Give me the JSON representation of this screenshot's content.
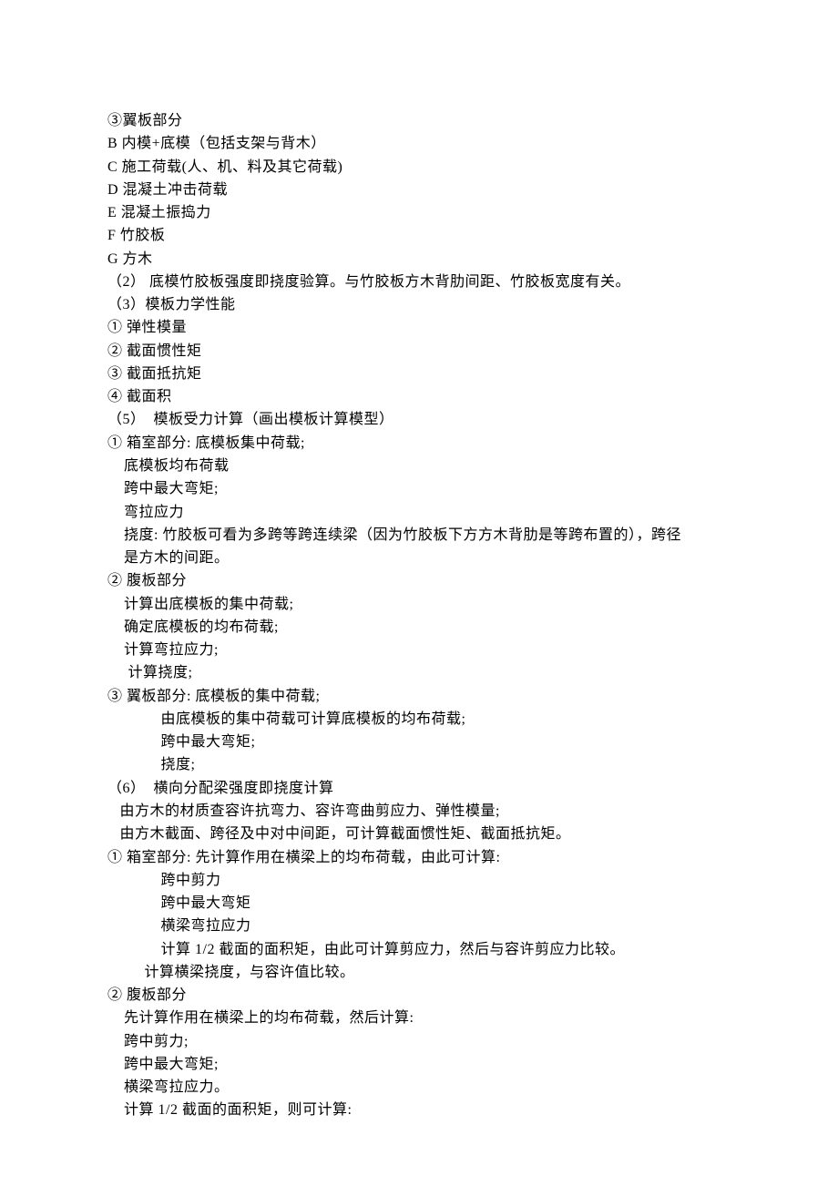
{
  "lines": [
    "③翼板部分",
    "B 内模+底模（包括支架与背木）",
    "C 施工荷载(人、机、料及其它荷载)",
    "D 混凝土冲击荷载",
    "E 混凝土振捣力",
    "F 竹胶板",
    "G 方木",
    "（2） 底模竹胶板强度即挠度验算。与竹胶板方木背肋间距、竹胶板宽度有关。",
    "（3）模板力学性能",
    "① 弹性模量",
    "② 截面惯性矩",
    "③ 截面抵抗矩",
    "④ 截面积",
    "（5）  模板受力计算（画出模板计算模型）",
    "① 箱室部分: 底模板集中荷载;",
    "    底模板均布荷载",
    "    跨中最大弯矩;",
    "    弯拉应力",
    "    挠度: 竹胶板可看为多跨等跨连续梁（因为竹胶板下方方木背肋是等跨布置的），跨径",
    "    是方木的间距。",
    "② 腹板部分",
    "    计算出底模板的集中荷载;",
    "    确定底模板的均布荷载;",
    "    计算弯拉应力;",
    "     计算挠度;",
    "③ 翼板部分: 底模板的集中荷载;",
    "             由底模板的集中荷载可计算底模板的均布荷载;",
    "             跨中最大弯矩;",
    "             挠度;",
    "（6）  横向分配梁强度即挠度计算",
    "   由方木的材质查容许抗弯力、容许弯曲剪应力、弹性模量;",
    "   由方木截面、跨径及中对中间距，可计算截面惯性矩、截面抵抗矩。",
    "① 箱室部分: 先计算作用在横梁上的均布荷载，由此可计算:",
    "             跨中剪力",
    "             跨中最大弯矩",
    "             横梁弯拉应力",
    "             计算 1/2 截面的面积矩，由此可计算剪应力，然后与容许剪应力比较。",
    "         计算横梁挠度，与容许值比较。",
    "② 腹板部分",
    "    先计算作用在横梁上的均布荷载，然后计算:",
    "    跨中剪力;",
    "    跨中最大弯矩;",
    "    横梁弯拉应力。",
    "    计算 1/2 截面的面积矩，则可计算:"
  ]
}
